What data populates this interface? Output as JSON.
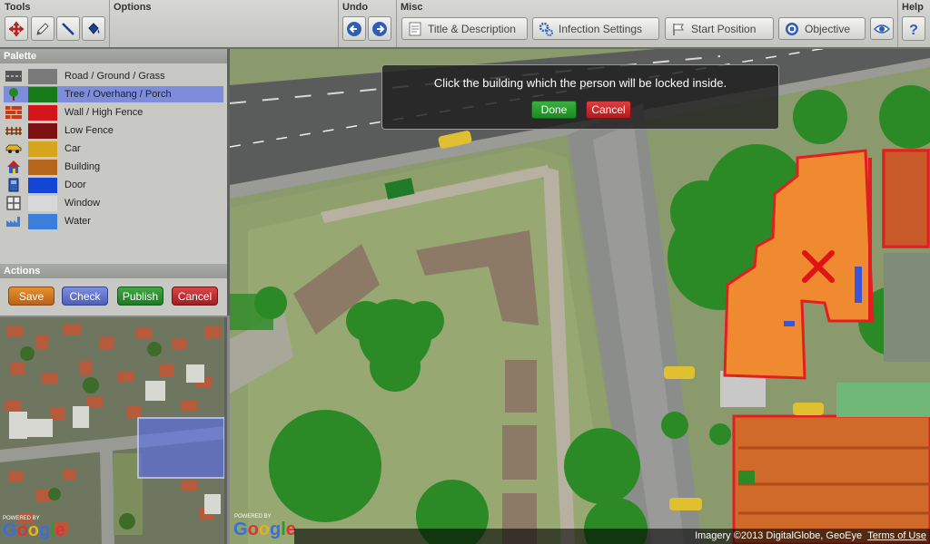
{
  "toolbar": {
    "sections": {
      "tools": "Tools",
      "options": "Options",
      "undo": "Undo",
      "misc": "Misc",
      "help": "Help"
    },
    "title_desc": "Title & Description",
    "infection": "Infection Settings",
    "start": "Start Position",
    "objective": "Objective"
  },
  "palette": {
    "header": "Palette",
    "items": [
      {
        "label": "Road / Ground / Grass",
        "color": "#7a7a7a",
        "icon": "road-icon"
      },
      {
        "label": "Tree / Overhang / Porch",
        "color": "#167a1b",
        "icon": "tree-icon"
      },
      {
        "label": "Wall / High Fence",
        "color": "#d3161a",
        "icon": "brick-wall-icon"
      },
      {
        "label": "Low Fence",
        "color": "#7c1212",
        "icon": "low-fence-icon"
      },
      {
        "label": "Car",
        "color": "#d6a51c",
        "icon": "car-icon"
      },
      {
        "label": "Building",
        "color": "#b8651c",
        "icon": "house-icon"
      },
      {
        "label": "Door",
        "color": "#1446d6",
        "icon": "door-icon"
      },
      {
        "label": "Window",
        "color": "#d8d8d8",
        "icon": "window-icon"
      },
      {
        "label": "Water",
        "color": "#3c7edb",
        "icon": "factory-water-icon"
      }
    ]
  },
  "actions": {
    "header": "Actions",
    "save": "Save",
    "check": "Check",
    "publish": "Publish",
    "cancel": "Cancel"
  },
  "dialog": {
    "message": "Click the building which the person will be locked inside.",
    "done": "Done",
    "cancel": "Cancel"
  },
  "map": {
    "powered_by": "POWERED BY",
    "google": "Google",
    "credits": "Imagery ©2013 DigitalGlobe, GeoEye",
    "terms": "Terms of Use"
  }
}
